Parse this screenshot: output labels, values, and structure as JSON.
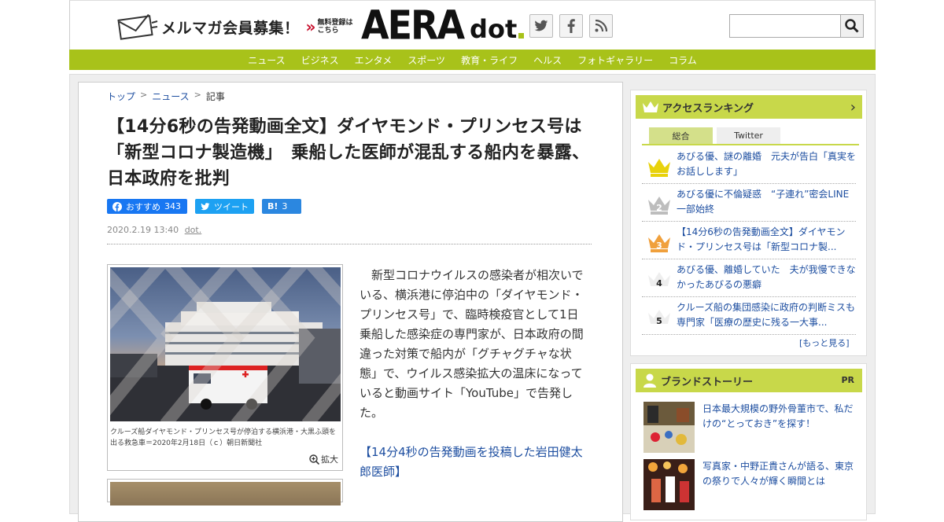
{
  "header": {
    "mail_text": "メルマガ会員募集！",
    "mail_sub": "無料登録は\nこちら",
    "logo_main": "AERA",
    "logo_sub": "dot",
    "social": [
      "twitter-icon",
      "facebook-icon",
      "rss-icon"
    ]
  },
  "nav": [
    "ニュース",
    "ビジネス",
    "エンタメ",
    "スポーツ",
    "教育・ライフ",
    "ヘルス",
    "フォトギャラリー",
    "コラム"
  ],
  "breadcrumb": {
    "top": "トップ",
    "news": "ニュース",
    "current": "記事"
  },
  "article": {
    "title": "【14分6秒の告発動画全文】ダイヤモンド・プリンセス号は「新型コロナ製造機」　乗船した医師が混乱する船内を暴露、日本政府を批判",
    "share": {
      "fb_label": "おすすめ",
      "fb_count": "343",
      "tw_label": "ツイート",
      "hb_label": "B!",
      "hb_count": "3"
    },
    "date": "2020.2.19 13:40",
    "source": "dot.",
    "caption": "クルーズ船ダイヤモンド・プリンセス号が停泊する横浜港・大黒ふ頭を出る救急車＝2020年2月18日（ｃ）朝日新聞社",
    "zoom": "拡大",
    "body": "新型コロナウイルスの感染者が相次いでいる、横浜港に停泊中の「ダイヤモンド・プリンセス号」で、臨時検疫官として1日乗船した感染症の専門家が、日本政府の間違った対策で船内が「グチャグチャな状態」で、ウイルス感染拡大の温床になっていると動画サイト「YouTube」で告発した。",
    "related": "【14分4秒の告発動画を投稿した岩田健太郎医師】"
  },
  "ranking": {
    "title": "アクセスランキング",
    "tabs": [
      "総合",
      "Twitter"
    ],
    "items": [
      {
        "rank": "1",
        "text": "あびる優、謎の離婚　元夫が告白「真実をお話しします」"
      },
      {
        "rank": "2",
        "text": "あびる優に不倫疑惑　“子連れ”密会LINE一部始終"
      },
      {
        "rank": "3",
        "text": "【14分6秒の告発動画全文】ダイヤモンド・プリンセス号は「新型コロナ製..."
      },
      {
        "rank": "4",
        "text": "あびる優、離婚していた　夫が我慢できなかったあびるの悪癖"
      },
      {
        "rank": "5",
        "text": "クルーズ船の集団感染に政府の判断ミスも　専門家「医療の歴史に残る一大事..."
      }
    ],
    "more": "[もっと見る]"
  },
  "brand": {
    "title": "ブランドストーリー",
    "pr": "PR",
    "items": [
      {
        "text": "日本最大規模の野外骨董市で、私だけの“とっておき”を探す！"
      },
      {
        "text": "写真家・中野正貴さんが語る、東京の祭りで人々が輝く瞬間とは"
      }
    ]
  },
  "colors": {
    "brand_green": "#a8c21a",
    "panel_green": "#c8d84a",
    "link_blue": "#1d4ea0"
  }
}
